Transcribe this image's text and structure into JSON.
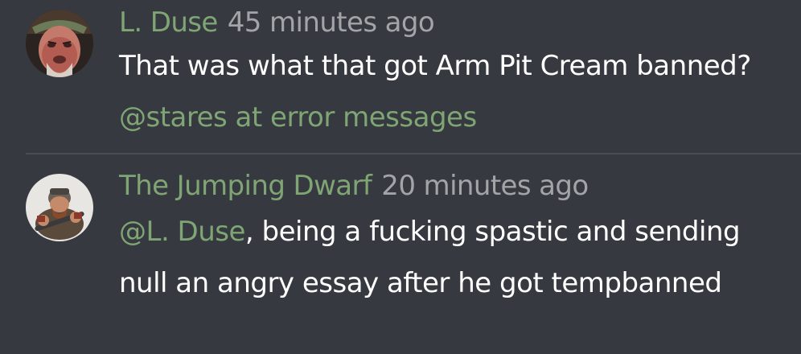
{
  "comments": [
    {
      "author": "L. Duse",
      "time": "45 minutes ago",
      "text_before": "That was what that got Arm Pit Cream banned? ",
      "mention": "@stares at error messages",
      "text_after": "",
      "avatar_icon": "user-avatar-icon"
    },
    {
      "author": "The Jumping Dwarf",
      "time": "20 minutes ago",
      "text_before": "",
      "mention": "@L. Duse",
      "text_after": ", being a fucking spastic and sending null an angry essay after he got tempbanned",
      "avatar_icon": "user-avatar-icon"
    }
  ],
  "colors": {
    "background": "#36393f",
    "author": "#7fa574",
    "mention": "#7fa574",
    "timestamp": "#a2a4a8",
    "text": "#ffffff",
    "divider": "#4b4e55"
  }
}
